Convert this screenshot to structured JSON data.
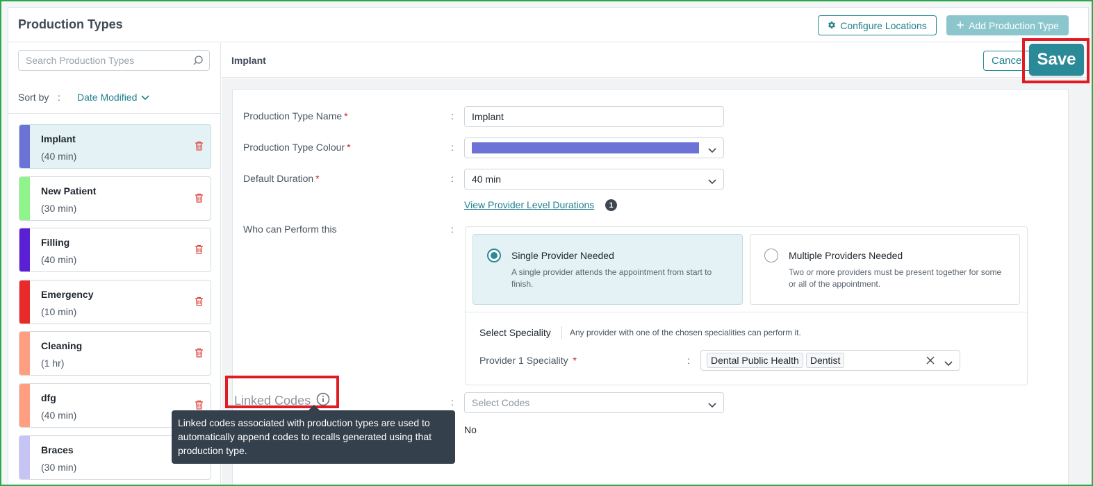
{
  "page": {
    "title": "Production Types"
  },
  "toolbar": {
    "configure_label": "Configure Locations",
    "add_label": "Add Production Type"
  },
  "sidebar": {
    "search_placeholder": "Search Production Types",
    "sort_label": "Sort by",
    "sort_colon": ":",
    "sort_value": "Date Modified",
    "items": [
      {
        "name": "Implant",
        "duration": "(40 min)",
        "color": "#6d72d7",
        "active": true
      },
      {
        "name": "New Patient",
        "duration": "(30 min)",
        "color": "#8ff58a",
        "active": false
      },
      {
        "name": "Filling",
        "duration": "(40 min)",
        "color": "#5b1fd6",
        "active": false
      },
      {
        "name": "Emergency",
        "duration": "(10 min)",
        "color": "#ea2a2a",
        "active": false
      },
      {
        "name": "Cleaning",
        "duration": "(1 hr)",
        "color": "#ff9e80",
        "active": false
      },
      {
        "name": "dfg",
        "duration": "(40 min)",
        "color": "#ff9e80",
        "active": false
      },
      {
        "name": "Braces",
        "duration": "(30 min)",
        "color": "#c5c4f5",
        "active": false
      }
    ]
  },
  "editor": {
    "title": "Implant",
    "cancel_label": "Cancel",
    "save_label": "Save",
    "colon": ":",
    "name_label": "Production Type Name",
    "name_value": "Implant",
    "colour_label": "Production Type Colour",
    "colour_value": "#6d72d7",
    "duration_label": "Default Duration",
    "duration_value": "40 min",
    "provider_durations_link": "View Provider Level Durations",
    "provider_durations_count": "1",
    "perform_label": "Who can Perform this",
    "options": [
      {
        "title": "Single Provider Needed",
        "desc": "A single provider attends the appointment from start to finish.",
        "selected": true
      },
      {
        "title": "Multiple Providers Needed",
        "desc": "Two or more providers must be present together for some or all of the appointment.",
        "selected": false
      }
    ],
    "speciality_title": "Select Speciality",
    "speciality_hint": "Any provider with one of the chosen specialities can perform it.",
    "provider1_label": "Provider 1 Speciality",
    "speciality_tags": [
      "Dental Public Health",
      "Dentist"
    ],
    "linked_codes_label": "Linked Codes",
    "linked_codes_placeholder": "Select Codes",
    "no_value": "No",
    "tooltip_text": "Linked codes associated with production types are used to automatically append codes to recalls generated using that production type.",
    "req_marker": "*"
  },
  "colors": {
    "accent": "#2b8a98",
    "highlight": "#e01b24",
    "frame": "#29a94a"
  }
}
